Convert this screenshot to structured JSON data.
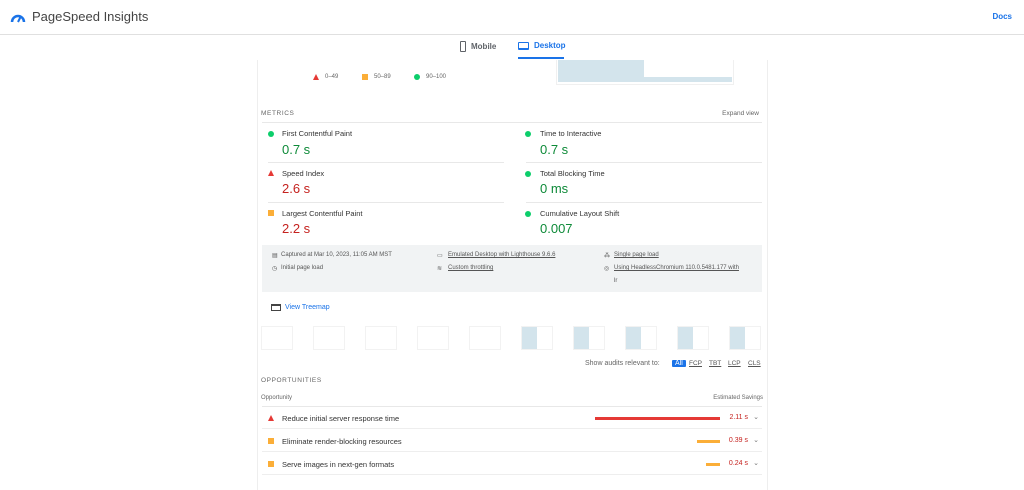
{
  "header": {
    "title": "PageSpeed Insights",
    "docs": "Docs"
  },
  "tabs": [
    {
      "label": "Mobile",
      "active": false
    },
    {
      "label": "Desktop",
      "active": true
    }
  ],
  "legend": [
    "0–49",
    "50–89",
    "90–100"
  ],
  "metrics": {
    "title": "METRICS",
    "expand": "Expand view",
    "items": [
      {
        "label": "First Contentful Paint",
        "value": "0.7 s",
        "status": "good"
      },
      {
        "label": "Time to Interactive",
        "value": "0.7 s",
        "status": "good"
      },
      {
        "label": "Speed Index",
        "value": "2.6 s",
        "status": "poor"
      },
      {
        "label": "Total Blocking Time",
        "value": "0 ms",
        "status": "good"
      },
      {
        "label": "Largest Contentful Paint",
        "value": "2.2 s",
        "status": "average"
      },
      {
        "label": "Cumulative Layout Shift",
        "value": "0.007",
        "status": "good"
      }
    ]
  },
  "info": {
    "captured": "Captured at Mar 10, 2023, 11:05 AM MST",
    "load": "Initial page load",
    "emulated": "Emulated Desktop with Lighthouse 9.6.6",
    "throttling": "Custom throttling",
    "single": "Single page load",
    "browser": "Using HeadlessChromium 110.0.5481.177 with",
    "browser2": "lr"
  },
  "treemap": "View Treemap",
  "filter": {
    "label": "Show audits relevant to:",
    "chips": [
      "All",
      "FCP",
      "TBT",
      "LCP",
      "CLS"
    ]
  },
  "opportunities": {
    "title": "OPPORTUNITIES",
    "col1": "Opportunity",
    "col2": "Estimated Savings",
    "rows": [
      {
        "name": "Reduce initial server response time",
        "savings": "2.11 s",
        "status": "poor",
        "fraction": 1.0
      },
      {
        "name": "Eliminate render-blocking resources",
        "savings": "0.39 s",
        "status": "average",
        "fraction": 0.18
      },
      {
        "name": "Serve images in next-gen formats",
        "savings": "0.24 s",
        "status": "average",
        "fraction": 0.11
      }
    ]
  },
  "colors": {
    "accent": "#1a73e8",
    "good": "#0cce6b",
    "average": "#fbae38",
    "poor": "#e53935"
  }
}
